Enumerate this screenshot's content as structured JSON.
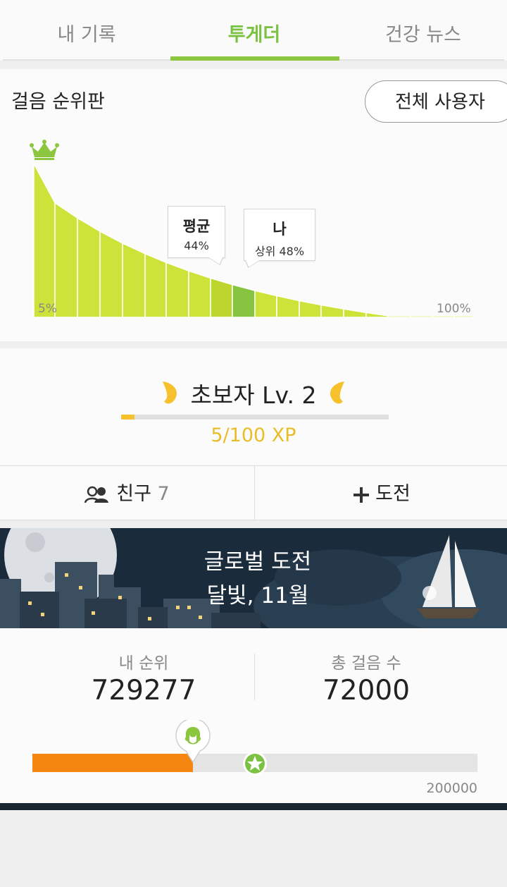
{
  "tabs": [
    {
      "label": "내 기록",
      "active": false
    },
    {
      "label": "투게더",
      "active": true
    },
    {
      "label": "건강 뉴스",
      "active": false
    }
  ],
  "leaderboard": {
    "title": "걸음 순위판",
    "scope_button": "전체 사용자",
    "avg_label": "평균",
    "avg_value": "44%",
    "me_label": "나",
    "me_value": "상위 48%",
    "axis_start": "5%",
    "axis_end": "100%"
  },
  "chart_data": {
    "type": "area",
    "x_start": "5%",
    "x_end": "100%",
    "annotations": [
      {
        "label": "평균",
        "value": "44%"
      },
      {
        "label": "나",
        "value": "상위 48%"
      }
    ],
    "colors": {
      "area": "#cde33a",
      "average": "#bcd62f",
      "me": "#86c440"
    }
  },
  "level": {
    "title": "초보자 Lv. 2",
    "xp_text": "5/100 XP",
    "xp_fraction": 0.05
  },
  "social": {
    "friends_label": "친구",
    "friends_count": "7",
    "challenge_label": "도전"
  },
  "global_challenge": {
    "title": "글로벌 도전",
    "subtitle": "달빛, 11월"
  },
  "stats": {
    "rank_label": "내 순위",
    "rank_value": "729277",
    "steps_label": "총 걸음 수",
    "steps_value": "72000",
    "goal_value": "200000",
    "progress_fraction": 0.36
  },
  "colors": {
    "accent_green": "#8cc63f",
    "xp_yellow": "#f5c22d",
    "progress_orange": "#f5860f"
  },
  "icons": [
    "crown-icon",
    "wing-left-icon",
    "wing-right-icon",
    "friends-icon",
    "plus-icon",
    "avatar-marker-icon",
    "star-marker-icon",
    "moon-icon",
    "sailboat-icon"
  ]
}
